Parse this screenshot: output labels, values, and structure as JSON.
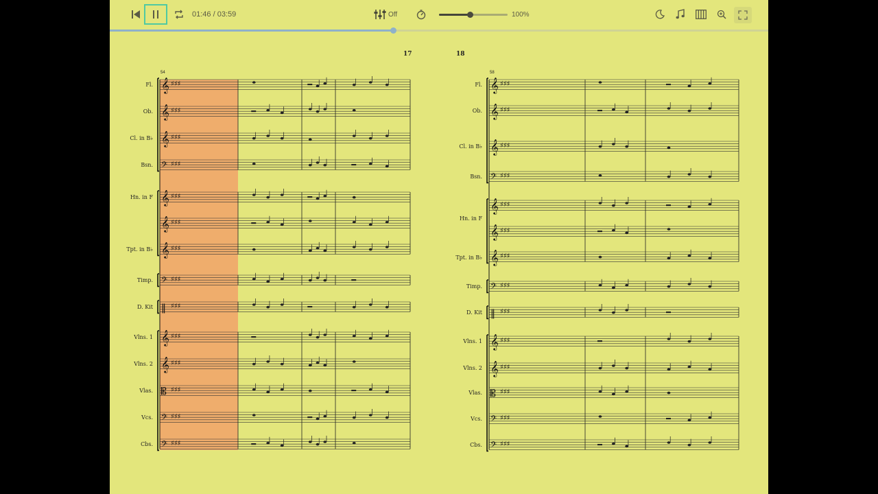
{
  "player": {
    "time": "01:46 / 03:59",
    "mixer_label": "Off",
    "volume_pct": "100%",
    "volume_value": 0.45,
    "progress_value": 0.43,
    "accent_color": "#4fc9a2",
    "icons": [
      "skip-back-icon",
      "pause-icon",
      "loop-icon",
      "mixer-icon",
      "metronome-icon",
      "night-mode-icon",
      "notes-icon",
      "piano-icon",
      "zoom-icon",
      "fullscreen-icon"
    ]
  },
  "score": {
    "highlight_color": "#f1a26a",
    "page_color": "#e3e67c",
    "system_left": {
      "bar_start": "54",
      "instruments": [
        "Fl.",
        "Ob.",
        "Cl. in B♭",
        "Bsn.",
        "Hn. in F",
        "",
        "Tpt. in B♭",
        "Timp.",
        "D. Kit",
        "Vlns. 1",
        "Vlns. 2",
        "Vlas.",
        "Vcs.",
        "Cbs."
      ]
    },
    "system_right": {
      "bar_start": "58",
      "instruments": [
        "Fl.",
        "Ob.",
        "Cl. in B♭",
        "Bsn.",
        "",
        "Hn. in F",
        "Tpt. in B♭",
        "Timp.",
        "D. Kit",
        "Vlns. 1",
        "Vlns. 2",
        "Vlas.",
        "Vcs.",
        "Cbs."
      ]
    },
    "bar_numbers": [
      "17",
      "18"
    ]
  }
}
